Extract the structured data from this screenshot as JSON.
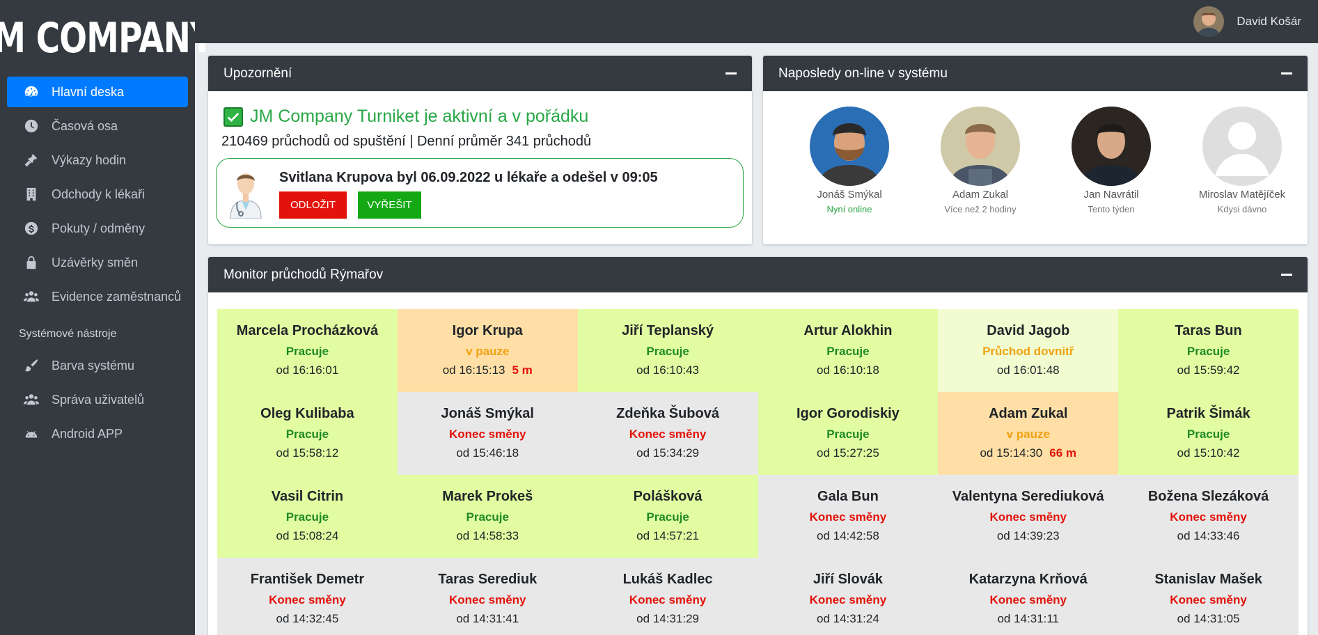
{
  "brand": "JM COMPANY",
  "user": {
    "name": "David Košár"
  },
  "nav": {
    "items": [
      {
        "label": "Hlavní deska",
        "icon": "dashboard-icon",
        "active": true
      },
      {
        "label": "Časová osa",
        "icon": "clock-icon"
      },
      {
        "label": "Výkazy hodin",
        "icon": "gavel-icon"
      },
      {
        "label": "Odchody k lékaři",
        "icon": "hospital-icon"
      },
      {
        "label": "Pokuty / odměny",
        "icon": "money-icon"
      },
      {
        "label": "Uzávěrky směn",
        "icon": "lock-icon"
      },
      {
        "label": "Evidence zaměstnanců",
        "icon": "users-icon"
      }
    ],
    "section_header": "Systémové nástroje",
    "tools": [
      {
        "label": "Barva systému",
        "icon": "brush-icon"
      },
      {
        "label": "Správa uživatelů",
        "icon": "users-icon"
      },
      {
        "label": "Android APP",
        "icon": "android-icon"
      }
    ]
  },
  "alerts": {
    "title": "Upozornění",
    "status_text": "JM Company Turniket je aktivní a v pořádku",
    "stats_text": "210469 průchodů od spuštění | Denní průměr 341 průchodů",
    "notice_text": "Svitlana Krupova byl 06.09.2022 u lékaře a odešel v 09:05",
    "postpone_label": "ODLOŽIT",
    "resolve_label": "VYŘEŠIT"
  },
  "online": {
    "title": "Naposledy on-line v systému",
    "users": [
      {
        "name": "Jonáš Smýkal",
        "status": "Nyní online",
        "online": true
      },
      {
        "name": "Adam Zukal",
        "status": "Více než 2 hodiny"
      },
      {
        "name": "Jan Navrátil",
        "status": "Tento týden"
      },
      {
        "name": "Miroslav Matějíček",
        "status": "Kdysi dávno"
      }
    ]
  },
  "monitor": {
    "title": "Monitor průchodů Rýmařov",
    "colors": {
      "working": "#e1fca1",
      "pause": "#ffdfa6",
      "entry": "#f2fcd0",
      "end": "#e8e8e8"
    },
    "cells": [
      {
        "name": "Marcela Procházková",
        "status": "Pracuje",
        "since": "od 16:16:01",
        "type": "working"
      },
      {
        "name": "Igor Krupa",
        "status": "v pauze",
        "since": "od 16:15:13",
        "duration": "5 m",
        "type": "pause"
      },
      {
        "name": "Jiří Teplanský",
        "status": "Pracuje",
        "since": "od 16:10:43",
        "type": "working"
      },
      {
        "name": "Artur Alokhin",
        "status": "Pracuje",
        "since": "od 16:10:18",
        "type": "working"
      },
      {
        "name": "David Jagob",
        "status": "Průchod dovnitř",
        "since": "od 16:01:48",
        "type": "entry"
      },
      {
        "name": "Taras Bun",
        "status": "Pracuje",
        "since": "od 15:59:42",
        "type": "working"
      },
      {
        "name": "Oleg Kulibaba",
        "status": "Pracuje",
        "since": "od 15:58:12",
        "type": "working"
      },
      {
        "name": "Jonáš Smýkal",
        "status": "Konec směny",
        "since": "od 15:46:18",
        "type": "end"
      },
      {
        "name": "Zdeňka Šubová",
        "status": "Konec směny",
        "since": "od 15:34:29",
        "type": "end"
      },
      {
        "name": "Igor Gorodiskiy",
        "status": "Pracuje",
        "since": "od 15:27:25",
        "type": "working"
      },
      {
        "name": "Adam Zukal",
        "status": "v pauze",
        "since": "od 15:14:30",
        "duration": "66 m",
        "type": "pause"
      },
      {
        "name": "Patrik Šimák",
        "status": "Pracuje",
        "since": "od 15:10:42",
        "type": "working"
      },
      {
        "name": "Vasil Citrin",
        "status": "Pracuje",
        "since": "od 15:08:24",
        "type": "working"
      },
      {
        "name": "Marek Prokeš",
        "status": "Pracuje",
        "since": "od 14:58:33",
        "type": "working"
      },
      {
        "name": "Polášková",
        "status": "Pracuje",
        "since": "od 14:57:21",
        "type": "working"
      },
      {
        "name": "Gala Bun",
        "status": "Konec směny",
        "since": "od 14:42:58",
        "type": "end"
      },
      {
        "name": "Valentyna Serediuková",
        "status": "Konec směny",
        "since": "od 14:39:23",
        "type": "end"
      },
      {
        "name": "Božena Slezáková",
        "status": "Konec směny",
        "since": "od 14:33:46",
        "type": "end"
      },
      {
        "name": "František Demetr",
        "status": "Konec směny",
        "since": "od 14:32:45",
        "type": "end"
      },
      {
        "name": "Taras Serediuk",
        "status": "Konec směny",
        "since": "od 14:31:41",
        "type": "end"
      },
      {
        "name": "Lukáš Kadlec",
        "status": "Konec směny",
        "since": "od 14:31:29",
        "type": "end"
      },
      {
        "name": "Jiří Slovák",
        "status": "Konec směny",
        "since": "od 14:31:24",
        "type": "end"
      },
      {
        "name": "Katarzyna Krňová",
        "status": "Konec směny",
        "since": "od 14:31:11",
        "type": "end"
      },
      {
        "name": "Stanislav Mašek",
        "status": "Konec směny",
        "since": "od 14:31:05",
        "type": "end"
      }
    ]
  }
}
